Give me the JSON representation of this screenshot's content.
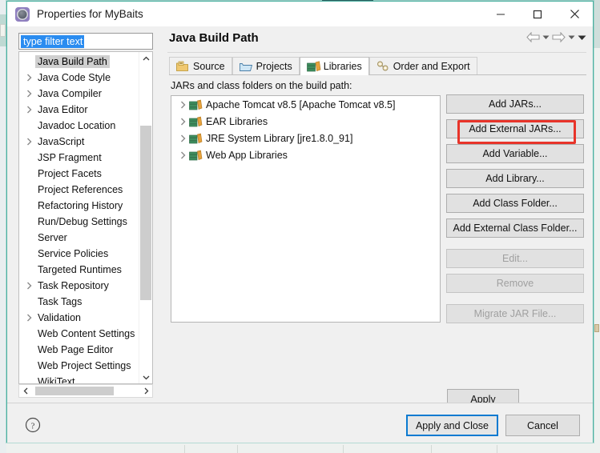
{
  "window": {
    "title": "Properties for MyBaits",
    "icon": "properties-icon",
    "minimize_label": "–",
    "maximize_label": "□",
    "close_label": "✕"
  },
  "filter": {
    "value": "type filter text",
    "placeholder": "type filter text"
  },
  "sidebar": {
    "items": [
      {
        "label": "Java Build Path",
        "expandable": false,
        "selected": true
      },
      {
        "label": "Java Code Style",
        "expandable": true,
        "selected": false
      },
      {
        "label": "Java Compiler",
        "expandable": true,
        "selected": false
      },
      {
        "label": "Java Editor",
        "expandable": true,
        "selected": false
      },
      {
        "label": "Javadoc Location",
        "expandable": false,
        "selected": false
      },
      {
        "label": "JavaScript",
        "expandable": true,
        "selected": false
      },
      {
        "label": "JSP Fragment",
        "expandable": false,
        "selected": false
      },
      {
        "label": "Project Facets",
        "expandable": false,
        "selected": false
      },
      {
        "label": "Project References",
        "expandable": false,
        "selected": false
      },
      {
        "label": "Refactoring History",
        "expandable": false,
        "selected": false
      },
      {
        "label": "Run/Debug Settings",
        "expandable": false,
        "selected": false
      },
      {
        "label": "Server",
        "expandable": false,
        "selected": false
      },
      {
        "label": "Service Policies",
        "expandable": false,
        "selected": false
      },
      {
        "label": "Targeted Runtimes",
        "expandable": false,
        "selected": false
      },
      {
        "label": "Task Repository",
        "expandable": true,
        "selected": false
      },
      {
        "label": "Task Tags",
        "expandable": false,
        "selected": false
      },
      {
        "label": "Validation",
        "expandable": true,
        "selected": false
      },
      {
        "label": "Web Content Settings",
        "expandable": false,
        "selected": false
      },
      {
        "label": "Web Page Editor",
        "expandable": false,
        "selected": false
      },
      {
        "label": "Web Project Settings",
        "expandable": false,
        "selected": false
      },
      {
        "label": "WikiText",
        "expandable": false,
        "selected": false
      }
    ]
  },
  "page": {
    "title": "Java Build Path",
    "nav": {
      "back_icon": "back-arrow-icon",
      "back_menu_icon": "chevron-down-icon",
      "forward_icon": "forward-arrow-icon",
      "forward_menu_icon": "chevron-down-icon",
      "more_icon": "chevron-down-icon"
    },
    "tabs": [
      {
        "label": "Source",
        "icon": "source-folder-icon",
        "active": false
      },
      {
        "label": "Projects",
        "icon": "projects-folder-icon",
        "active": false
      },
      {
        "label": "Libraries",
        "icon": "libraries-icon",
        "active": true
      },
      {
        "label": "Order and Export",
        "icon": "order-export-icon",
        "active": false
      }
    ],
    "list_label": "JARs and class folders on the build path:",
    "libraries": [
      {
        "label": "Apache Tomcat v8.5 [Apache Tomcat v8.5]",
        "icon": "library-icon"
      },
      {
        "label": "EAR Libraries",
        "icon": "library-icon"
      },
      {
        "label": "JRE System Library [jre1.8.0_91]",
        "icon": "library-icon"
      },
      {
        "label": "Web App Libraries",
        "icon": "library-icon"
      }
    ],
    "buttons": [
      {
        "label": "Add JARs...",
        "disabled": false,
        "highlighted": true
      },
      {
        "label": "Add External JARs...",
        "disabled": false,
        "highlighted": false
      },
      {
        "label": "Add Variable...",
        "disabled": false,
        "highlighted": false
      },
      {
        "label": "Add Library...",
        "disabled": false,
        "highlighted": false
      },
      {
        "label": "Add Class Folder...",
        "disabled": false,
        "highlighted": false
      },
      {
        "label": "Add External Class Folder...",
        "disabled": false,
        "highlighted": false
      },
      {
        "label": "Edit...",
        "disabled": true,
        "highlighted": false
      },
      {
        "label": "Remove",
        "disabled": true,
        "highlighted": false
      },
      {
        "label": "Migrate JAR File...",
        "disabled": true,
        "highlighted": false
      }
    ],
    "apply_label": "Apply"
  },
  "footer": {
    "help_icon": "help-question-icon",
    "apply_and_close_label": "Apply and Close",
    "cancel_label": "Cancel"
  },
  "colors": {
    "annotation": "#e8342a",
    "dialog_border": "#49b0a0",
    "selection": "#2a8cf0",
    "default_button_border": "#0a7ad1"
  }
}
